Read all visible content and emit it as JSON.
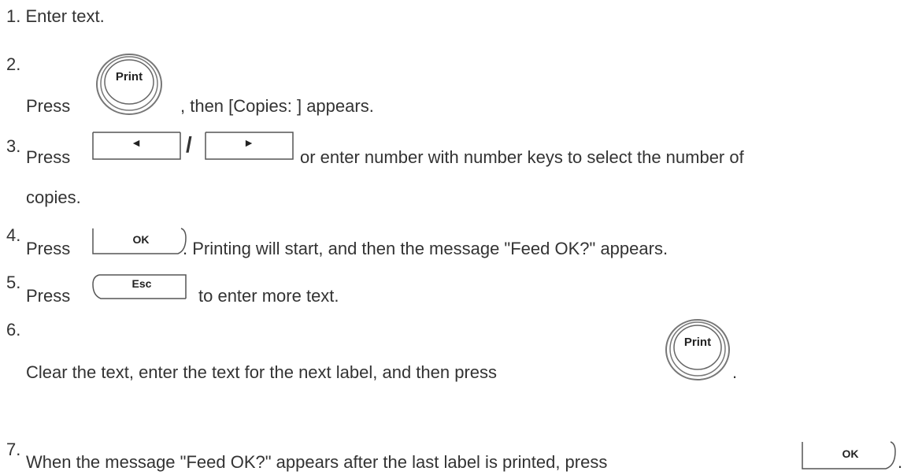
{
  "steps": [
    {
      "number": "1.",
      "text": "Enter text."
    },
    {
      "number": "2.",
      "before": "Press",
      "after": ", then [Copies: ] appears."
    },
    {
      "number": "3.",
      "before": "Press",
      "separator": "/",
      "after": "or enter number with number keys to select the number of",
      "continuation": "copies."
    },
    {
      "number": "4.",
      "before": "Press",
      "after": ". Printing will start, and then the message \"Feed OK?\" appears."
    },
    {
      "number": "5.",
      "before": "Press",
      "after": "to enter more text."
    },
    {
      "number": "6.",
      "text": "Clear the text, enter the text for the next label, and then press",
      "after": "."
    },
    {
      "number": "7.",
      "text": "When the message \"Feed OK?\" appears after the last label is printed, press",
      "after": "."
    }
  ],
  "keys": {
    "print": "Print",
    "left": "◄",
    "right": "►",
    "ok": "OK",
    "esc": "Esc"
  },
  "icons": {
    "print_button": "print-key-icon",
    "left_arrow": "left-arrow-key-icon",
    "right_arrow": "right-arrow-key-icon",
    "ok_button": "ok-key-icon",
    "esc_button": "esc-key-icon"
  }
}
